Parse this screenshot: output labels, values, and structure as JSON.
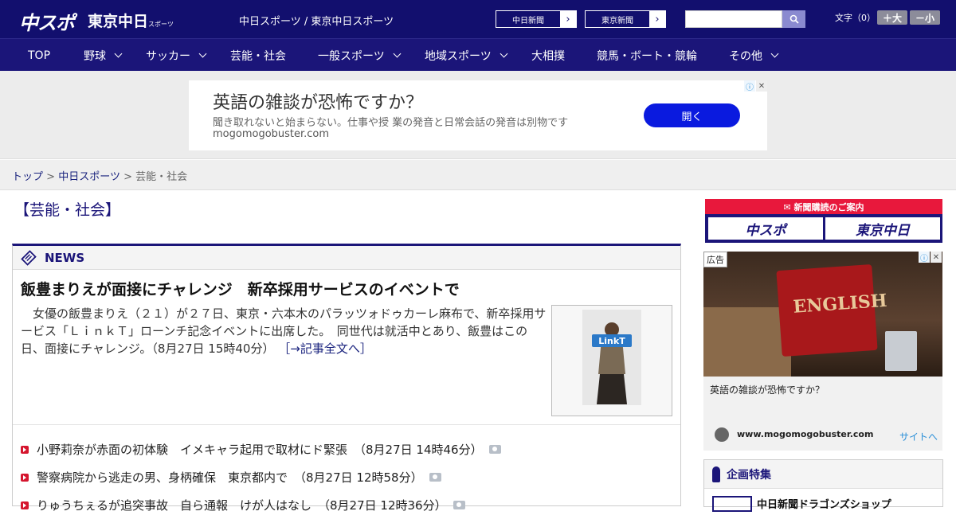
{
  "header": {
    "logo_chuspo": "中スポ",
    "logo_tokyo": "東京中日",
    "logo_tokyo_sub": "スポーツ",
    "site_links": "中日スポーツ / 東京中日スポーツ",
    "paper_buttons": [
      "中日新聞",
      "東京新聞"
    ],
    "search_placeholder": "",
    "fontsize_label": "文字（0）",
    "fontsize_up": "＋大",
    "fontsize_down": "－小"
  },
  "nav": {
    "items": [
      {
        "label": "TOP"
      },
      {
        "label": "野球"
      },
      {
        "label": "サッカー"
      },
      {
        "label": "芸能・社会"
      },
      {
        "label": "一般スポーツ"
      },
      {
        "label": "地域スポーツ"
      },
      {
        "label": "大相撲"
      },
      {
        "label": "競馬・ボート・競輪"
      },
      {
        "label": "その他"
      }
    ]
  },
  "top_ad": {
    "title": "英語の雑談が恐怖ですか？",
    "description": "聞き取れないと始まらない。仕事や授 業の発音と日常会話の発音は別物です",
    "url": "mogomogobuster.com",
    "button": "開く"
  },
  "breadcrumb": {
    "home": "トップ",
    "sep": ">",
    "parent": "中日スポーツ",
    "current": "芸能・社会"
  },
  "main": {
    "section_title": "【芸能・社会】",
    "news_label": "NEWS",
    "headline": "飯豊まりえが面接にチャレンジ　新卒採用サービスのイベントで",
    "lead": "　女優の飯豊まりえ（２１）が２７日、東京・六本木のパラッツォドゥカーレ麻布で、新卒採用サービス「ＬｉｎｋＴ」ローンチ記念イベントに出席した。　同世代は就活中とあり、飯豊はこの日、面接にチャレンジ。（8月27日 15時40分）",
    "lead_more": "［→記事全文へ］",
    "thumb_text": "LinkT",
    "news_list": [
      {
        "title": "小野莉奈が赤面の初体験　イメキャラ起用で取材にド緊張",
        "time": "（8月27日 14時46分）"
      },
      {
        "title": "警察病院から逃走の男、身柄確保　東京都内で",
        "time": "（8月27日 12時58分）"
      },
      {
        "title": "りゅうちぇるが追突事故　自ら通報　けが人はなし",
        "time": "（8月27日 12時36分）"
      }
    ]
  },
  "sidebar": {
    "subscribe_title": "新聞購読のご案内",
    "subscribe_buttons": [
      "中スポ",
      "東京中日"
    ],
    "ad_badge": "広告",
    "ad_image_text": "ENGLISH",
    "ad_text": "英語の雑談が恐怖ですか？",
    "ad_domain": "www.mogomogobuster.com",
    "ad_visit": "サイトへ",
    "feature_title": "企画特集",
    "feature_item": "中日新聞ドラゴンズショップ"
  },
  "colors": {
    "brand_navy": "#120f6e",
    "nav_navy": "#1b1579",
    "accent_red": "#d5162e",
    "ad_button_blue": "#0a1adf"
  }
}
